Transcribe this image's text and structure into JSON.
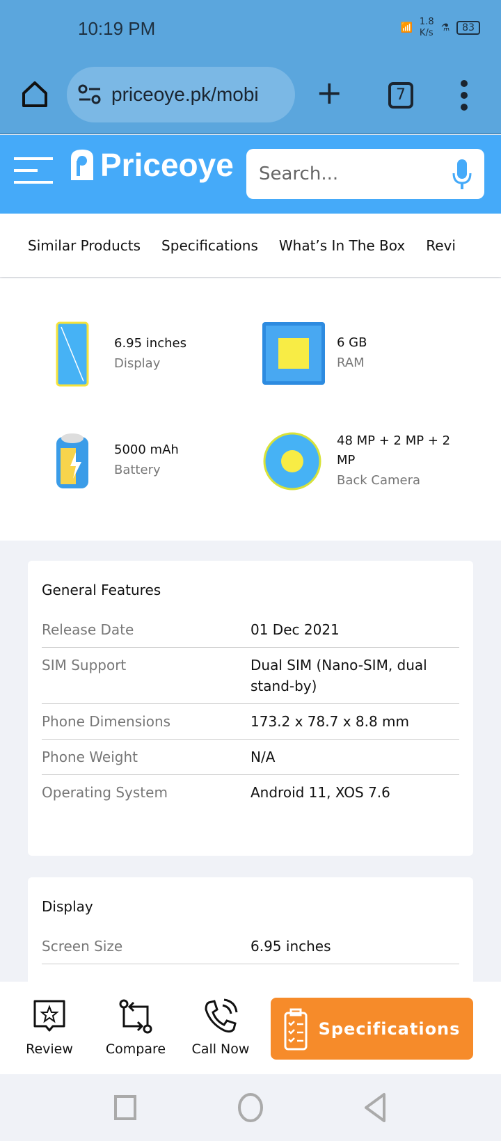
{
  "status": {
    "time": "10:19 PM",
    "net_speed_value": "1.8",
    "net_speed_unit": "K/s",
    "battery": "83"
  },
  "browser": {
    "url": "priceoye.pk/mobi",
    "tab_count": "7"
  },
  "header": {
    "logo": "Priceoye",
    "search_placeholder": "Search..."
  },
  "nav_tabs": [
    "Similar Products",
    "Specifications",
    "What’s In The Box",
    "Revi"
  ],
  "highlights": [
    {
      "value": "6.95 inches",
      "label": "Display",
      "icon": "phone-display-icon"
    },
    {
      "value": "6 GB",
      "label": "RAM",
      "icon": "chip-icon"
    },
    {
      "value": "5000 mAh",
      "label": "Battery",
      "icon": "battery-icon"
    },
    {
      "value": "48 MP + 2 MP + 2 MP",
      "label": "Back Camera",
      "icon": "camera-aperture-icon"
    }
  ],
  "general": {
    "title": "General Features",
    "rows": [
      {
        "k": "Release Date",
        "v": "01 Dec 2021"
      },
      {
        "k": "SIM Support",
        "v": "Dual SIM (Nano-SIM, dual stand-by)"
      },
      {
        "k": "Phone Dimensions",
        "v": "173.2 x 78.7 x 8.8 mm"
      },
      {
        "k": "Phone Weight",
        "v": "N/A"
      },
      {
        "k": "Operating System",
        "v": "Android 11, XOS 7.6"
      }
    ]
  },
  "display": {
    "title": "Display",
    "rows": [
      {
        "k": "Screen Size",
        "v": "6.95 inches"
      }
    ]
  },
  "bottom_bar": {
    "review": "Review",
    "compare": "Compare",
    "call": "Call Now",
    "specs": "Specifications"
  },
  "colors": {
    "header": "#45aaf9",
    "browser": "#5ba6dd",
    "accent": "#f68b2a"
  }
}
